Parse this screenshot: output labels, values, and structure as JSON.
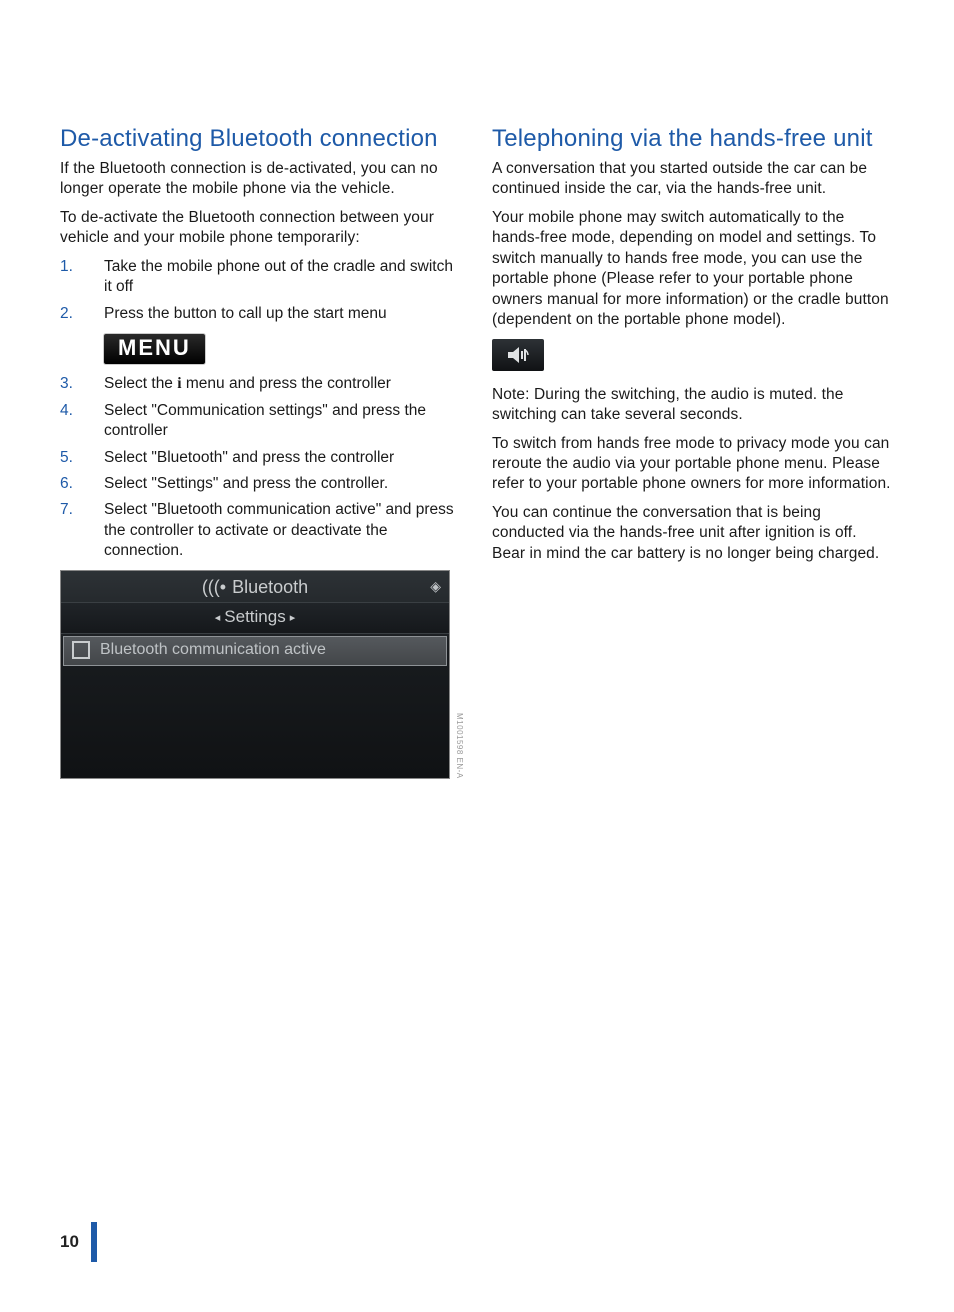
{
  "page_number": "10",
  "left": {
    "title": "De-activating Bluetooth connection",
    "p1": "If the Bluetooth connection is de-activated, you can no longer operate the mobile phone via the vehicle.",
    "p2": "To de-activate the Bluetooth connection between your vehicle and your mobile phone temporarily:",
    "steps": {
      "s1": "Take the mobile phone out of the cradle and switch it off",
      "s2": "Press the button to call up the start menu",
      "s3_pre": "Select the ",
      "s3_post": " menu and press the controller",
      "s4": "Select \"Communication settings\" and press the controller",
      "s5": "Select \"Bluetooth\" and press the controller",
      "s6": "Select \"Settings\" and press the controller.",
      "s7": "Select \"Bluetooth communication active\" and press the controller to activate or deactivate the connection."
    },
    "menu_label": "MENU",
    "screenshot": {
      "header": "Bluetooth",
      "sub": "Settings",
      "row": "Bluetooth communication active",
      "code": "M1001598 EN-A"
    }
  },
  "right": {
    "title": "Telephoning via the hands-free unit",
    "p1": "A conversation that you started outside the car can be continued inside the car, via the hands-free unit.",
    "p2": "Your mobile phone may switch automatically to the hands-free mode, depending on model and settings. To switch manually to hands free mode, you can use the portable phone (Please refer to your portable phone owners manual for more information) or the cradle button (dependent on the portable phone model).",
    "note": "Note: During the switching, the audio is muted. the switching can take several seconds.",
    "p3": "To switch from hands free mode to privacy mode you can reroute the audio via your portable phone menu. Please refer to your portable phone owners for more information.",
    "p4": "You can continue the conversation that is being conducted via the hands-free unit after ignition is off. Bear in mind the car battery is no longer being charged."
  },
  "icons": {
    "info": "i",
    "bluetooth_waves": "(((•",
    "nav_diamond": "◈",
    "arrow_left": "◂",
    "arrow_right": "▸"
  }
}
